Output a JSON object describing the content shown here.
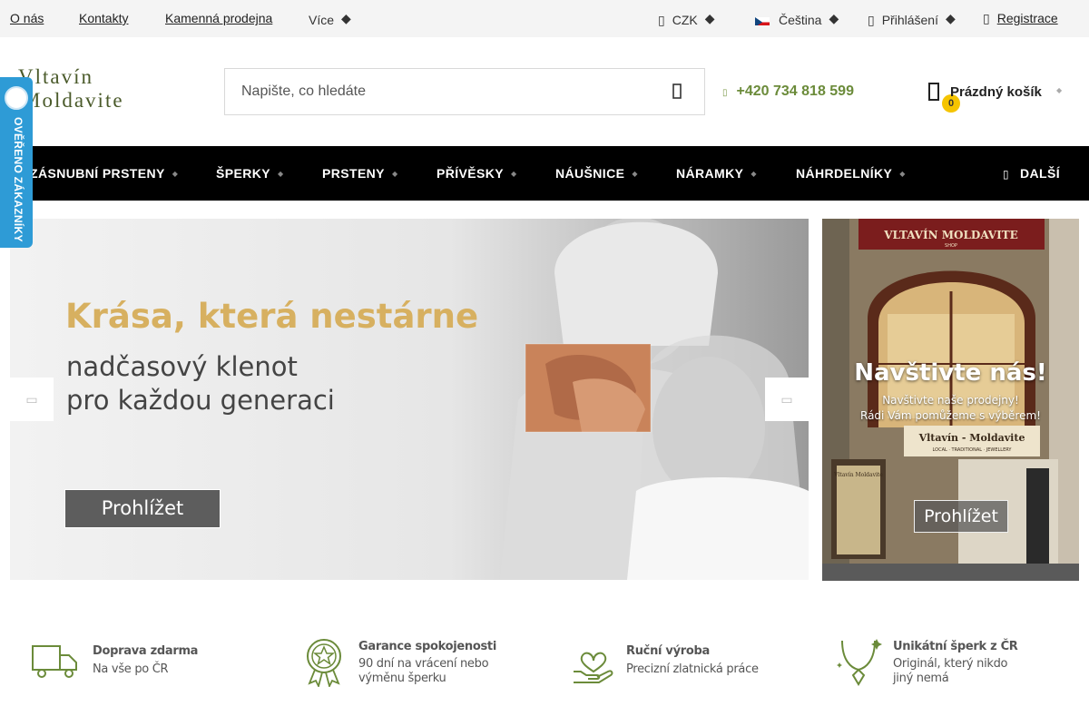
{
  "topbar": {
    "links": [
      "O nás",
      "Kontakty",
      "Kamenná prodejna"
    ],
    "more": "Více",
    "currency": "CZK",
    "language": "Čeština",
    "login": "Přihlášení",
    "register": "Registrace"
  },
  "header": {
    "logo_line1": "Vltavín",
    "logo_line2": "Moldavite",
    "search_placeholder": "Napište, co hledáte",
    "phone": "+420 734 818 599",
    "cart_label": "Prázdný košík",
    "cart_count": "0"
  },
  "side_badge": {
    "text": "OVĚŘENO ZÁKAZNÍKY"
  },
  "nav": {
    "items": [
      "ZÁSNUBNÍ PRSTENY",
      "ŠPERKY",
      "PRSTENY",
      "PŘÍVĚSKY",
      "NÁUŠNICE",
      "NÁRAMKY",
      "NÁHRDELNÍKY"
    ],
    "more": "DALŠÍ"
  },
  "hero": {
    "title": "Krása, která nestárne",
    "subtitle_line1": "nadčasový klenot",
    "subtitle_line2": "pro každou generaci",
    "button": "Prohlížet"
  },
  "promo": {
    "sign_top": "VLTAVÍN MOLDAVITE",
    "sign_small": "SHOP",
    "title": "Navštivte nás!",
    "line1": "Navštivte naše prodejny!",
    "line2": "Rádi Vám pomůžeme s výběrem!",
    "sign_bottom": "Vltavín - Moldavite",
    "sign_bottom_sub": "LOCAL · TRADITIONAL · JEWELLERY",
    "window_sign": "Vltavín Moldavite",
    "button": "Prohlížet"
  },
  "features": [
    {
      "title": "Doprava zdarma",
      "lines": [
        "Na vše po ČR"
      ],
      "icon": "truck-icon"
    },
    {
      "title": "Garance spokojenosti",
      "lines": [
        "90 dní na vrácení nebo",
        "výměnu šperku"
      ],
      "icon": "star-badge-icon"
    },
    {
      "title": "Ruční výroba",
      "lines": [
        "Precizní zlatnická práce"
      ],
      "icon": "hand-heart-icon"
    },
    {
      "title": "Unikátní šperk z ČR",
      "lines": [
        "Originál, který nikdo",
        "jiný nemá"
      ],
      "icon": "necklace-icon"
    }
  ],
  "colors": {
    "accent_green": "#6b8b3a",
    "nav_bg": "#000000",
    "badge_blue": "#2e9bd6",
    "cart_badge": "#f5c400",
    "hero_gold": "#d7b060"
  }
}
